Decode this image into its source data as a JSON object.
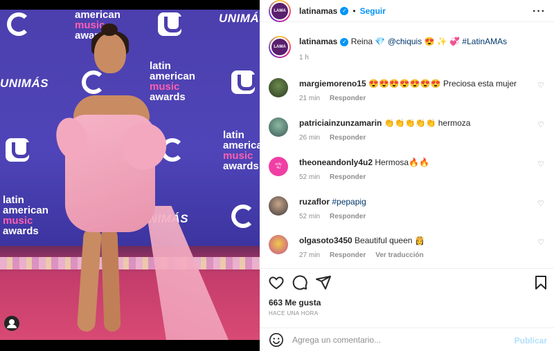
{
  "photo": {
    "logos": {
      "lama_line1": "latin",
      "lama_line2": "american",
      "lama_line3": "music",
      "lama_line4": "awards",
      "unimas": "UNIMÁS"
    },
    "tag_icon": "user-tag-icon"
  },
  "header": {
    "username": "latinamas",
    "separator": "•",
    "follow_label": "Seguir",
    "more_icon": "more-options-icon",
    "more_glyph": "···"
  },
  "caption": {
    "username": "latinamas",
    "text_before": "Reina 💎",
    "mention": "@chiquis",
    "text_after": "😍 ✨ 💞",
    "hashtag": "#LatinAMAs",
    "time": "1 h"
  },
  "comments": [
    {
      "username": "margiemoreno15",
      "text": "😍😍😍😍😍😍😍 Preciosa esta mujer",
      "time": "21 min",
      "reply_label": "Responder",
      "translate_label": ""
    },
    {
      "username": "patriciainzunzamarin",
      "text": "👏👏👏👏👏 hermoza",
      "time": "26 min",
      "reply_label": "Responder",
      "translate_label": ""
    },
    {
      "username": "theoneandonly4u2",
      "text": "Hermosa🔥🔥",
      "time": "52 min",
      "reply_label": "Responder",
      "translate_label": ""
    },
    {
      "username": "ruzaflor",
      "text": "#pepapig",
      "time": "52 min",
      "reply_label": "Responder",
      "translate_label": ""
    },
    {
      "username": "olgasoto3450",
      "text": "Beautiful queen 👸",
      "time": "27 min",
      "reply_label": "Responder",
      "translate_label": "Ver traducción"
    }
  ],
  "actions": {
    "like_icon": "heart-icon",
    "comment_icon": "comment-icon",
    "share_icon": "share-icon",
    "save_icon": "bookmark-icon",
    "likes": "663 Me gusta",
    "ago": "HACE UNA HORA"
  },
  "composer": {
    "emoji_icon": "emoji-icon",
    "placeholder": "Agrega un comentario...",
    "publish_label": "Publicar"
  },
  "colors": {
    "accent": "#0095f6",
    "muted": "#8e8e8e",
    "publish_disabled": "#b2dffc"
  }
}
